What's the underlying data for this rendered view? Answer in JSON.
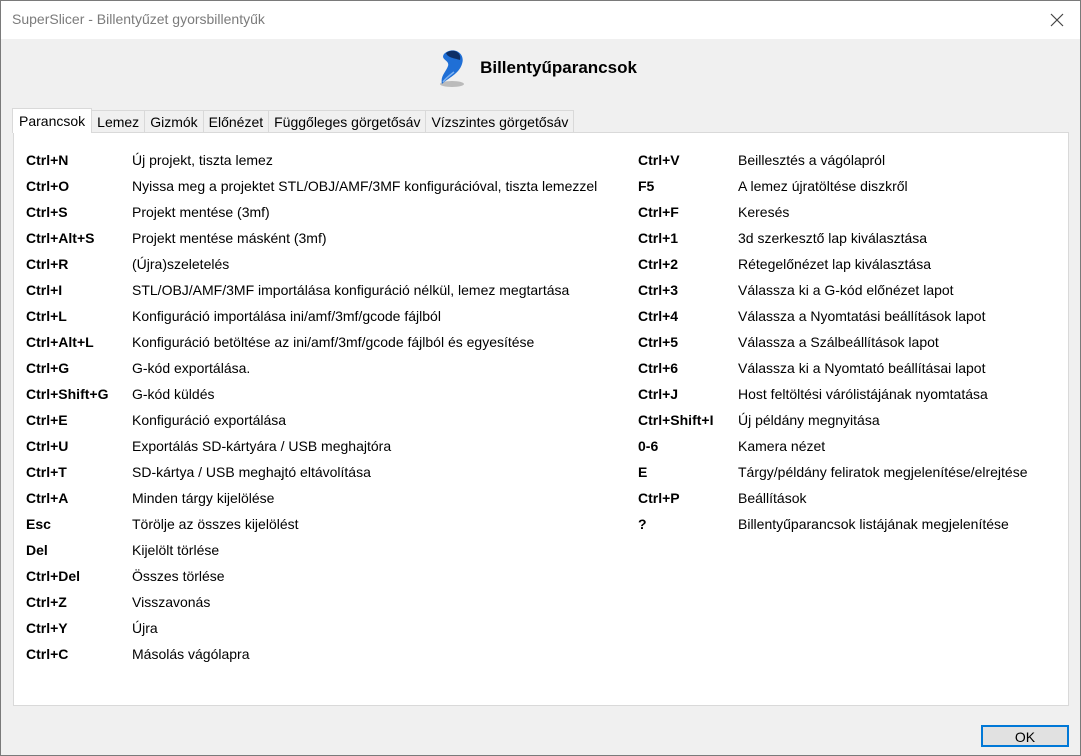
{
  "window": {
    "title": "SuperSlicer - Billentyűzet gyorsbillentyűk"
  },
  "header": {
    "heading": "Billentyűparancsok"
  },
  "tabs": [
    {
      "label": "Parancsok",
      "active": true
    },
    {
      "label": "Lemez"
    },
    {
      "label": "Gizmók"
    },
    {
      "label": "Előnézet"
    },
    {
      "label": "Függőleges görgetősáv"
    },
    {
      "label": "Vízszintes görgetősáv"
    }
  ],
  "shortcuts_left": [
    {
      "key": "Ctrl+N",
      "desc": "Új projekt, tiszta lemez"
    },
    {
      "key": "Ctrl+O",
      "desc": "Nyissa meg a projektet STL/OBJ/AMF/3MF konfigurációval, tiszta lemezzel"
    },
    {
      "key": "Ctrl+S",
      "desc": "Projekt mentése (3mf)"
    },
    {
      "key": "Ctrl+Alt+S",
      "desc": "Projekt mentése másként (3mf)"
    },
    {
      "key": "Ctrl+R",
      "desc": "(Újra)szeletelés"
    },
    {
      "key": "Ctrl+I",
      "desc": "STL/OBJ/AMF/3MF importálása konfiguráció nélkül, lemez megtartása"
    },
    {
      "key": "Ctrl+L",
      "desc": "Konfiguráció importálása ini/amf/3mf/gcode fájlból"
    },
    {
      "key": "Ctrl+Alt+L",
      "desc": "Konfiguráció betöltése az ini/amf/3mf/gcode fájlból és egyesítése"
    },
    {
      "key": "Ctrl+G",
      "desc": "G-kód exportálása."
    },
    {
      "key": "Ctrl+Shift+G",
      "desc": "G-kód küldés"
    },
    {
      "key": "Ctrl+E",
      "desc": "Konfiguráció exportálása"
    },
    {
      "key": "Ctrl+U",
      "desc": "Exportálás SD-kártyára / USB meghajtóra"
    },
    {
      "key": "Ctrl+T",
      "desc": "SD-kártya / USB meghajtó eltávolítása"
    },
    {
      "key": "Ctrl+A",
      "desc": "Minden tárgy kijelölése"
    },
    {
      "key": "Esc",
      "desc": "Törölje az összes kijelölést"
    },
    {
      "key": "Del",
      "desc": "Kijelölt törlése"
    },
    {
      "key": "Ctrl+Del",
      "desc": "Összes törlése"
    },
    {
      "key": "Ctrl+Z",
      "desc": "Visszavonás"
    },
    {
      "key": "Ctrl+Y",
      "desc": "Újra"
    },
    {
      "key": "Ctrl+C",
      "desc": "Másolás vágólapra"
    }
  ],
  "shortcuts_right": [
    {
      "key": "Ctrl+V",
      "desc": "Beillesztés a vágólapról"
    },
    {
      "key": "F5",
      "desc": "A lemez újratöltése diszkről"
    },
    {
      "key": "Ctrl+F",
      "desc": "Keresés"
    },
    {
      "key": "Ctrl+1",
      "desc": "3d szerkesztő lap kiválasztása"
    },
    {
      "key": "Ctrl+2",
      "desc": "Rétegelőnézet lap kiválasztása"
    },
    {
      "key": "Ctrl+3",
      "desc": "Válassza ki a G-kód előnézet lapot"
    },
    {
      "key": "Ctrl+4",
      "desc": "Válassza a Nyomtatási beállítások lapot"
    },
    {
      "key": "Ctrl+5",
      "desc": "Válassza a Szálbeállítások lapot"
    },
    {
      "key": "Ctrl+6",
      "desc": "Válassza ki a Nyomtató beállításai lapot"
    },
    {
      "key": "Ctrl+J",
      "desc": "Host feltöltési várólistájának nyomtatása"
    },
    {
      "key": "Ctrl+Shift+I",
      "desc": "Új példány megnyitása"
    },
    {
      "key": "0-6",
      "desc": "Kamera nézet"
    },
    {
      "key": "E",
      "desc": "Tárgy/példány feliratok megjelenítése/elrejtése"
    },
    {
      "key": "Ctrl+P",
      "desc": "Beállítások"
    },
    {
      "key": "?",
      "desc": "Billentyűparancsok listájának megjelenítése"
    }
  ],
  "footer": {
    "ok_label": "OK"
  },
  "colors": {
    "title_text": "#7b7b7b",
    "accent": "#0078d7",
    "logo_blue": "#1f6fd6"
  }
}
